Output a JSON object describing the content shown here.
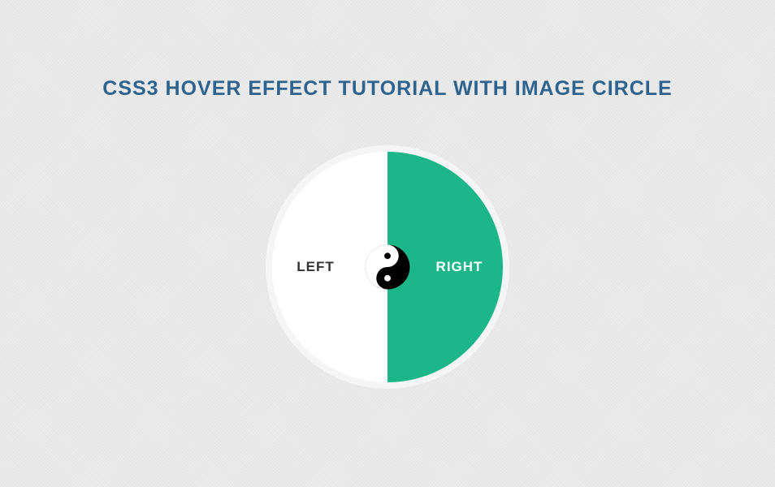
{
  "page": {
    "title": "CSS3 HOVER EFFECT TUTORIAL WITH IMAGE CIRCLE"
  },
  "circle": {
    "left_label": "LEFT",
    "right_label": "RIGHT",
    "right_bg_color": "#1cb688",
    "center_icon": "yinyang"
  }
}
